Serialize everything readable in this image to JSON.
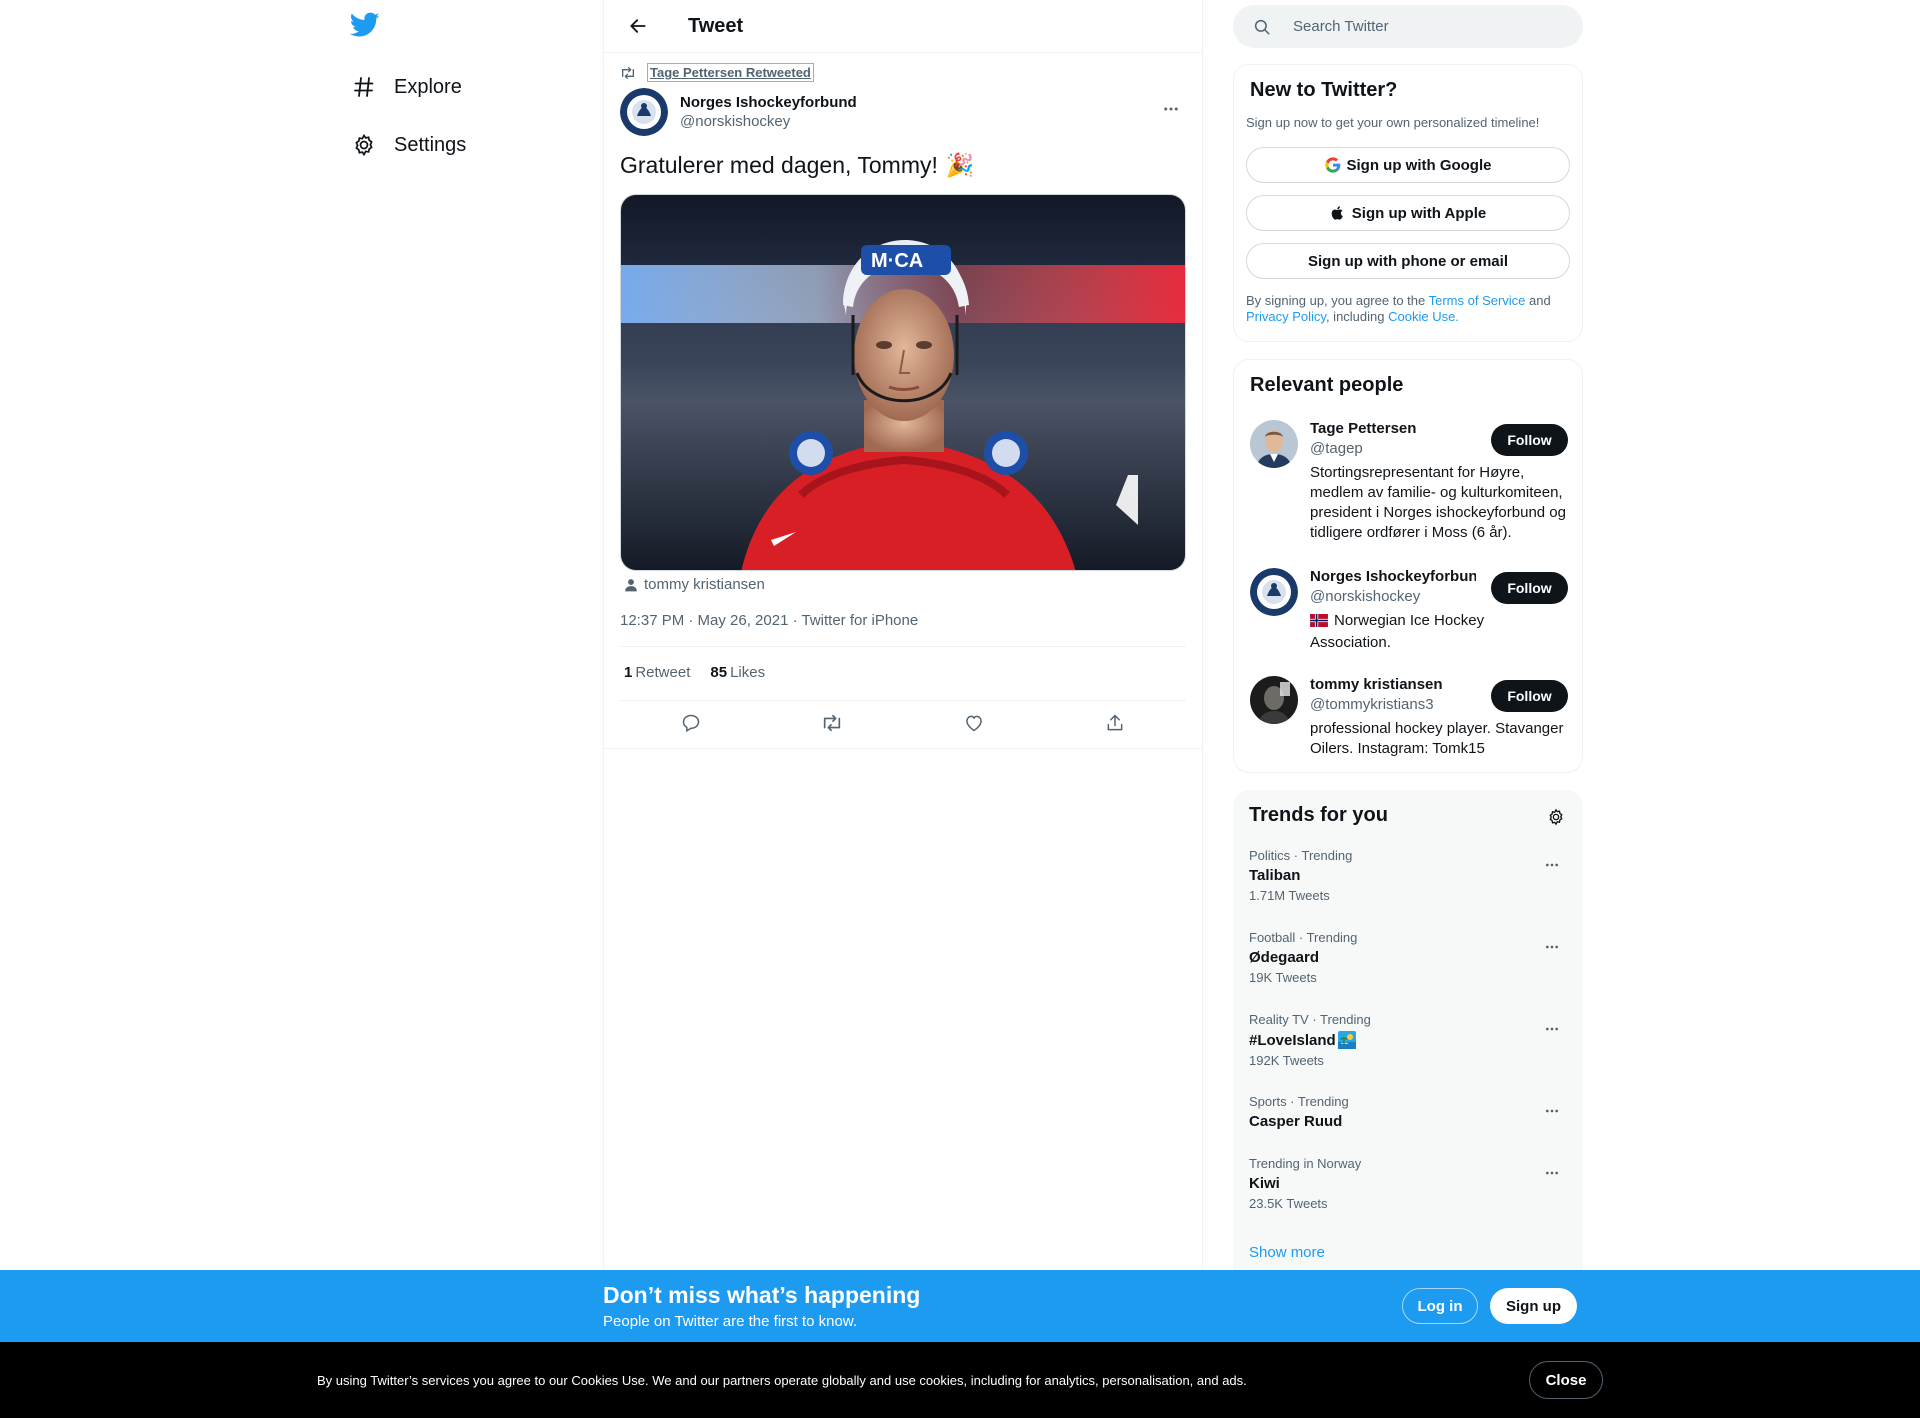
{
  "nav": {
    "items": [
      {
        "label": "Explore"
      },
      {
        "label": "Settings"
      }
    ]
  },
  "header": {
    "title": "Tweet"
  },
  "tweet": {
    "retweeted_by": "Tage Pettersen Retweeted",
    "author_name": "Norges Ishockeyforbund",
    "author_handle": "@norskishockey",
    "text": "Gratulerer med dagen, Tommy!",
    "emoji": "🎉",
    "tagged_user": "tommy kristiansen",
    "meta": "12:37 PM · May 26, 2021 · Twitter for iPhone",
    "retweet_count": "1",
    "retweet_label": "Retweet",
    "like_count": "85",
    "like_label": "Likes"
  },
  "search": {
    "placeholder": "Search Twitter"
  },
  "new_to_twitter": {
    "title": "New to Twitter?",
    "subtitle": "Sign up now to get your own personalized timeline!",
    "google_label": "Sign up with Google",
    "apple_label": "Sign up with Apple",
    "phone_label": "Sign up with phone or email",
    "terms_prefix": "By signing up, you agree to the ",
    "terms_link": "Terms of Service",
    "terms_and": " and ",
    "privacy_link": "Privacy Policy",
    "terms_including": ", including ",
    "cookie_link": "Cookie Use."
  },
  "relevant_people": {
    "title": "Relevant people",
    "follow_label": "Follow",
    "people": [
      {
        "name": "Tage Pettersen",
        "handle": "@tagep",
        "bio": "Stortingsrepresentant for Høyre, medlem av familie- og kulturkomiteen, president i Norges ishockeyforbund og tidligere ordfører i Moss (6 år)."
      },
      {
        "name": "Norges Ishockeyforbund",
        "handle": "@norskishockey",
        "bio": "Norwegian Ice Hockey Association."
      },
      {
        "name": "tommy kristiansen",
        "handle": "@tommykristians3",
        "bio": "professional hockey player. Stavanger Oilers. Instagram: Tomk15"
      }
    ]
  },
  "trends": {
    "title": "Trends for you",
    "items": [
      {
        "context": "Politics · Trending",
        "name": "Taliban",
        "count": "1.71M Tweets"
      },
      {
        "context": "Football · Trending",
        "name": "Ødegaard",
        "count": "19K Tweets"
      },
      {
        "context": "Reality TV · Trending",
        "name": "#LoveIsland",
        "count": "192K Tweets"
      },
      {
        "context": "Sports · Trending",
        "name": "Casper Ruud",
        "count": ""
      },
      {
        "context": "Trending in Norway",
        "name": "Kiwi",
        "count": "23.5K Tweets"
      }
    ],
    "show_more": "Show more"
  },
  "cta": {
    "title": "Don’t miss what’s happening",
    "subtitle": "People on Twitter are the first to know.",
    "login": "Log in",
    "signup": "Sign up"
  },
  "cookie": {
    "text": "By using Twitter’s services you agree to our Cookies Use. We and our partners operate globally and use cookies, including for analytics, personalisation, and ads.",
    "close": "Close"
  },
  "colors": {
    "brand": "#1d9bf0",
    "text_primary": "#0f1419",
    "text_secondary": "#536471",
    "follow_button": "#0f1419",
    "cookie_bar": "#000000"
  },
  "icons": [
    "twitter-logo-icon",
    "hashtag-icon",
    "gear-icon",
    "back-arrow-icon",
    "retweet-icon",
    "more-icon",
    "person-icon",
    "reply-icon",
    "like-icon",
    "share-icon",
    "search-icon",
    "google-icon",
    "apple-icon",
    "norway-flag-icon",
    "island-icon"
  ]
}
